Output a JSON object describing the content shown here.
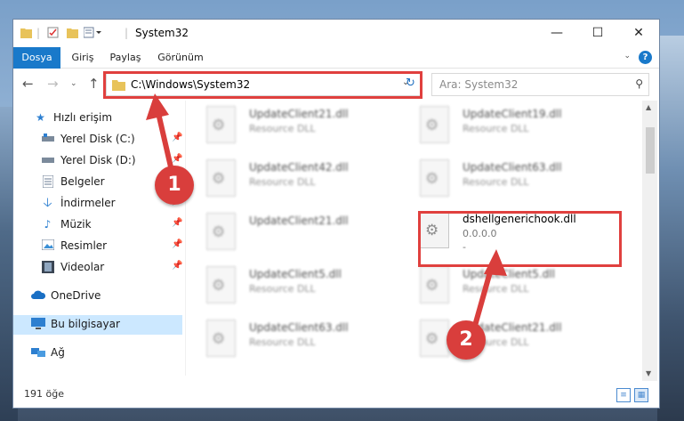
{
  "window": {
    "title": "System32",
    "controls": {
      "minimize": "—",
      "maximize": "☐",
      "close": "✕"
    }
  },
  "ribbon": {
    "tabs": [
      "Dosya",
      "Giriş",
      "Paylaş",
      "Görünüm"
    ],
    "help_label": "?"
  },
  "address": {
    "path": "C:\\Windows\\System32",
    "search_placeholder": "Ara: System32"
  },
  "sidebar": {
    "items": [
      {
        "label": "Hızlı erişim",
        "icon": "star-icon"
      },
      {
        "label": "Yerel Disk (C:)",
        "icon": "drive-icon"
      },
      {
        "label": "Yerel Disk (D:)",
        "icon": "drive-icon"
      },
      {
        "label": "Belgeler",
        "icon": "document-icon"
      },
      {
        "label": "İndirmeler",
        "icon": "download-icon"
      },
      {
        "label": "Müzik",
        "icon": "music-icon"
      },
      {
        "label": "Resimler",
        "icon": "pictures-icon"
      },
      {
        "label": "Videolar",
        "icon": "video-icon"
      },
      {
        "label": "OneDrive",
        "icon": "cloud-icon"
      },
      {
        "label": "Bu bilgisayar",
        "icon": "computer-icon"
      },
      {
        "label": "Ağ",
        "icon": "network-icon"
      }
    ]
  },
  "files": [
    {
      "name": "UpdateClient21.dll",
      "type": "Resource DLL"
    },
    {
      "name": "UpdateClient19.dll",
      "type": "Resource DLL"
    },
    {
      "name": "UpdateClient42.dll",
      "type": "Resource DLL"
    },
    {
      "name": "UpdateClient63.dll",
      "type": "Resource DLL"
    },
    {
      "name": "UpdateClient21.dll",
      "type": ""
    },
    {
      "name": "dshellgenerichook.dll",
      "type": "0.0.0.0",
      "extra": "-"
    },
    {
      "name": "UpdateClient5.dll",
      "type": "Resource DLL"
    },
    {
      "name": "UpdateClient5.dll",
      "type": "Resource DLL"
    },
    {
      "name": "UpdateClient63.dll",
      "type": "Resource DLL"
    },
    {
      "name": "UpdateClient21.dll",
      "type": "Resource DLL"
    }
  ],
  "status": {
    "count": "191 öğe"
  },
  "annotations": {
    "step1": "1",
    "step2": "2"
  },
  "colors": {
    "accent": "#1979ca",
    "highlight": "#e0403e",
    "badge": "#d93e3c"
  }
}
